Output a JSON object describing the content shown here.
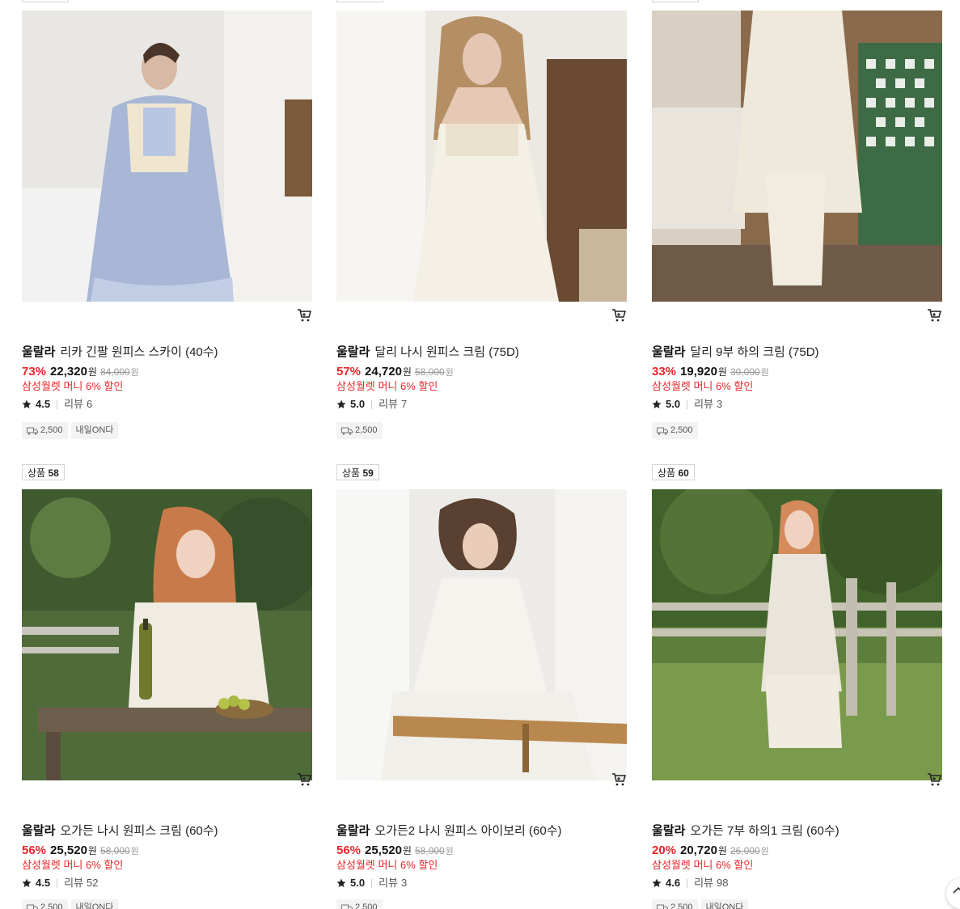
{
  "row1": [
    {
      "brand": "울랄라",
      "name": "리카 긴팔 원피스 스카이 (40수)",
      "discount": "73%",
      "price": "22,320",
      "won": "원",
      "original_price": "84,000",
      "original_won": "원",
      "benefit": "삼성월렛 머니 6% 할인",
      "rating": "4.5",
      "review_label": "리뷰",
      "review_count": "6",
      "shipping_fee": "2,500",
      "delivery_tag": "내일ON다",
      "image_alt": "blue long-sleeve nightgown with lace collar"
    },
    {
      "brand": "울랄라",
      "name": "달리 나시 원피스 크림 (75D)",
      "discount": "57%",
      "price": "24,720",
      "won": "원",
      "original_price": "58,000",
      "original_won": "원",
      "benefit": "삼성월렛 머니 6% 할인",
      "rating": "5.0",
      "review_label": "리뷰",
      "review_count": "7",
      "shipping_fee": "2,500",
      "delivery_tag": ""
    },
    {
      "brand": "울랄라",
      "name": "달리 9부 하의 크림 (75D)",
      "discount": "33%",
      "price": "19,920",
      "won": "원",
      "original_price": "30,000",
      "original_won": "원",
      "benefit": "삼성월렛 머니 6% 할인",
      "rating": "5.0",
      "review_label": "리뷰",
      "review_count": "3",
      "shipping_fee": "2,500",
      "delivery_tag": ""
    }
  ],
  "row2": [
    {
      "badge_label": "상품",
      "badge_num": "58",
      "brand": "울랄라",
      "name": "오가든 나시 원피스 크림 (60수)",
      "discount": "56%",
      "price": "25,520",
      "won": "원",
      "original_price": "58,000",
      "original_won": "원",
      "benefit": "삼성월렛 머니 6% 할인",
      "rating": "4.5",
      "review_label": "리뷰",
      "review_count": "52",
      "shipping_fee": "2,500",
      "delivery_tag": "내일ON다"
    },
    {
      "badge_label": "상품",
      "badge_num": "59",
      "brand": "울랄라",
      "name": "오가든2 나시 원피스 아이보리 (60수)",
      "discount": "56%",
      "price": "25,520",
      "won": "원",
      "original_price": "58,000",
      "original_won": "원",
      "benefit": "삼성월렛 머니 6% 할인",
      "rating": "5.0",
      "review_label": "리뷰",
      "review_count": "3",
      "shipping_fee": "2,500",
      "delivery_tag": ""
    },
    {
      "badge_label": "상품",
      "badge_num": "60",
      "brand": "울랄라",
      "name": "오가든 7부 하의1 크림 (60수)",
      "discount": "20%",
      "price": "20,720",
      "won": "원",
      "original_price": "26,000",
      "original_won": "원",
      "benefit": "삼성월렛 머니 6% 할인",
      "rating": "4.6",
      "review_label": "리뷰",
      "review_count": "98",
      "shipping_fee": "2,500",
      "delivery_tag": "내일ON다"
    }
  ],
  "colors": {
    "discount": "#e8262b",
    "benefit": "#e8262b",
    "tag_bg": "#f3f3f3"
  },
  "icons": {
    "cart": "cart-icon",
    "star": "star-icon",
    "truck": "truck-icon",
    "scroll_top": "arrow-up-icon"
  }
}
